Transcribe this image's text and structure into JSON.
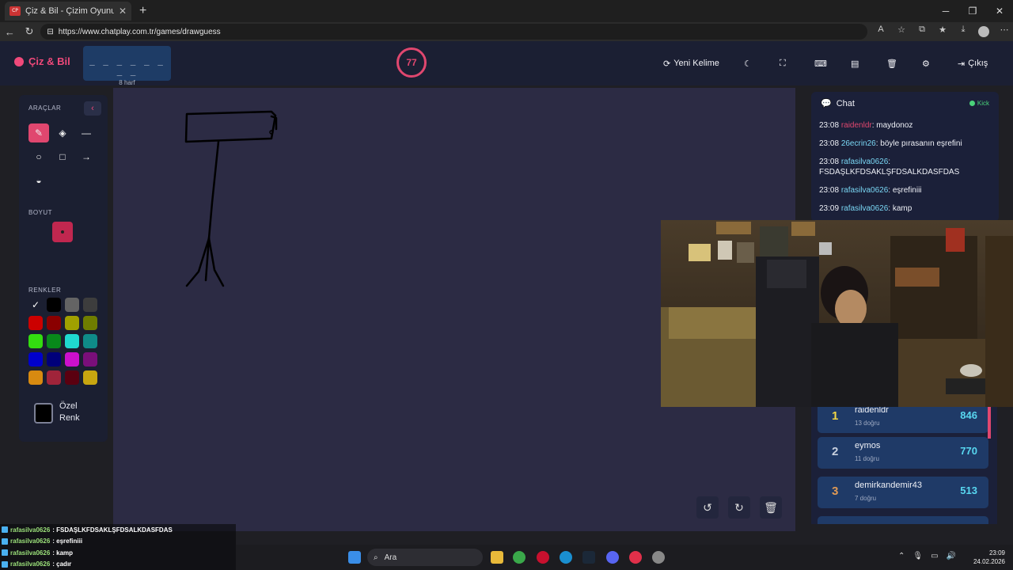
{
  "browser": {
    "tab_title": "Çiz & Bil - Çizim Oyunu",
    "tab_favicon": "CP",
    "url": "https://www.chatplay.com.tr/games/drawguess"
  },
  "app": {
    "logo": "Çiz & Bil",
    "word_mask": "_ _ _ _ _ _ _ _",
    "word_length": "8 harf",
    "timer": "77",
    "header_buttons": {
      "new_word": "Yeni Kelime",
      "exit": "Çıkış"
    }
  },
  "tools": {
    "title": "ARAÇLAR",
    "size_title": "BOYUT",
    "colors_title": "RENKLER",
    "custom_color": "Özel Renk",
    "colors": [
      "#000000",
      "#646464",
      "#3d3d3d",
      "#cc0000",
      "#8a0000",
      "#a0a000",
      "#6f7d00",
      "#33dd10",
      "#08891a",
      "#1fd9d0",
      "#0f8b88",
      "#0000cc",
      "#00007a",
      "#cc10cc",
      "#7a0f7a",
      "#d88a10",
      "#a0243a",
      "#5a0010",
      "#c8a610"
    ]
  },
  "chat": {
    "title": "Chat",
    "platform": "Kick",
    "messages": [
      {
        "time": "23:08",
        "user": "raidenldr",
        "text": ": maydonoz"
      },
      {
        "time": "23:08",
        "user": "26ecrin26",
        "text": ": böyle pırasanın eşrefini"
      },
      {
        "time": "23:08",
        "user": "rafasilva0626",
        "text": ": FSDAŞLKFDSAKLŞFDSALKDASFDAS"
      },
      {
        "time": "23:08",
        "user": "rafasilva0626",
        "text": ": eşrefiniii"
      },
      {
        "time": "23:09",
        "user": "rafasilva0626",
        "text": ": kamp"
      }
    ]
  },
  "leaderboard": [
    {
      "rank": "1",
      "name": "raidenldr",
      "correct": "13 doğru",
      "score": "846"
    },
    {
      "rank": "2",
      "name": "eymos",
      "correct": "11 doğru",
      "score": "770"
    },
    {
      "rank": "3",
      "name": "demirkandemir43",
      "correct": "7 doğru",
      "score": "513"
    }
  ],
  "stream_chat": [
    {
      "user": "rafasilva0626",
      "text": ": FSDAŞLKFDSAKLŞFDSALKDASFDAS"
    },
    {
      "user": "rafasilva0626",
      "text": ": eşrefiniii"
    },
    {
      "user": "rafasilva0626",
      "text": ": kamp"
    },
    {
      "user": "rafasilva0626",
      "text": ": çadır"
    }
  ],
  "taskbar": {
    "search": "Ara",
    "time": "23:09",
    "date": "24.02.2026"
  }
}
